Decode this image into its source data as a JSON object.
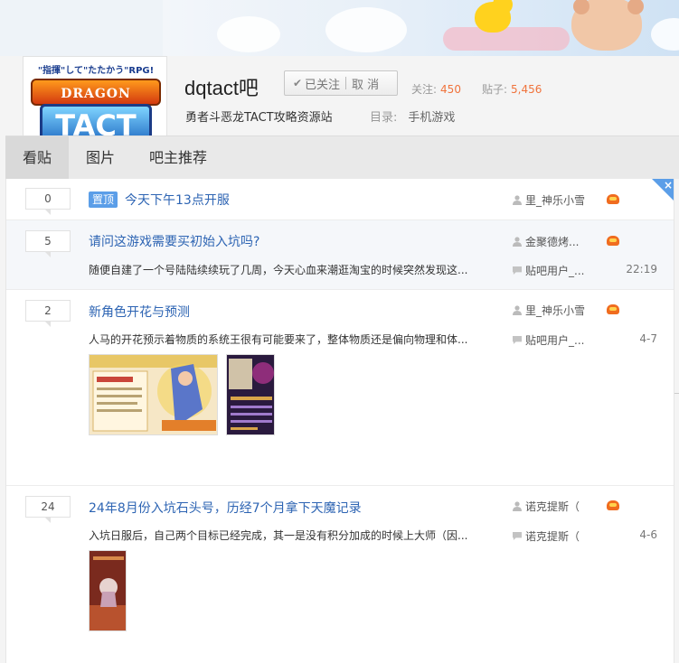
{
  "header": {
    "logo": {
      "top_text": "\"指揮\"して\"たたかう\"RPG!",
      "dq_text": "DRAGON QUEST",
      "tact_text": "TACT"
    },
    "forum_name": "dqtact吧",
    "follow_button": {
      "followed_label": "已关注",
      "cancel_label": "取 消"
    },
    "stats": {
      "follow_label": "关注:",
      "follow_count": "450",
      "posts_label": "贴子:",
      "posts_count": "5,456"
    },
    "slogan": "勇者斗恶龙TACT攻略资源站",
    "catalog_label": "目录:",
    "catalog_value": "手机游戏"
  },
  "tabs": [
    {
      "label": "看贴",
      "active": true
    },
    {
      "label": "图片",
      "active": false
    },
    {
      "label": "吧主推荐",
      "active": false
    }
  ],
  "threads": [
    {
      "replies": "0",
      "pin": "置顶",
      "title": "今天下午13点开服",
      "author": "里_神乐小雪"
    },
    {
      "replies": "5",
      "title": "请问这游戏需要买初始入坑吗?",
      "summary": "随便自建了一个号陆陆续续玩了几周，今天心血来潮逛淘宝的时候突然发现这...",
      "author": "金聚德烤...",
      "last_reply": "贴吧用户_...",
      "time": "22:19"
    },
    {
      "replies": "2",
      "title": "新角色开花与预测",
      "summary": "人马的开花预示着物质的系统王很有可能要来了，整体物质还是偏向物理和体...",
      "author": "里_神乐小雪",
      "last_reply": "贴吧用户_...",
      "time": "4-7"
    },
    {
      "replies": "24",
      "title": "24年8月份入坑石头号，历经7个月拿下天魔记录",
      "summary": "入坑日服后，自己两个目标已经完成，其一是没有积分加成的时候上大师（因...",
      "author": "诺克提斯（",
      "last_reply": "诺克提斯（",
      "time": "4-6"
    }
  ],
  "icons": {
    "user": "user-icon",
    "reply": "reply-icon",
    "badge": "level-badge-icon",
    "close": "close-icon"
  },
  "colors": {
    "link": "#2d64b3",
    "accent": "#f0733c",
    "pin": "#5b9ee8"
  }
}
